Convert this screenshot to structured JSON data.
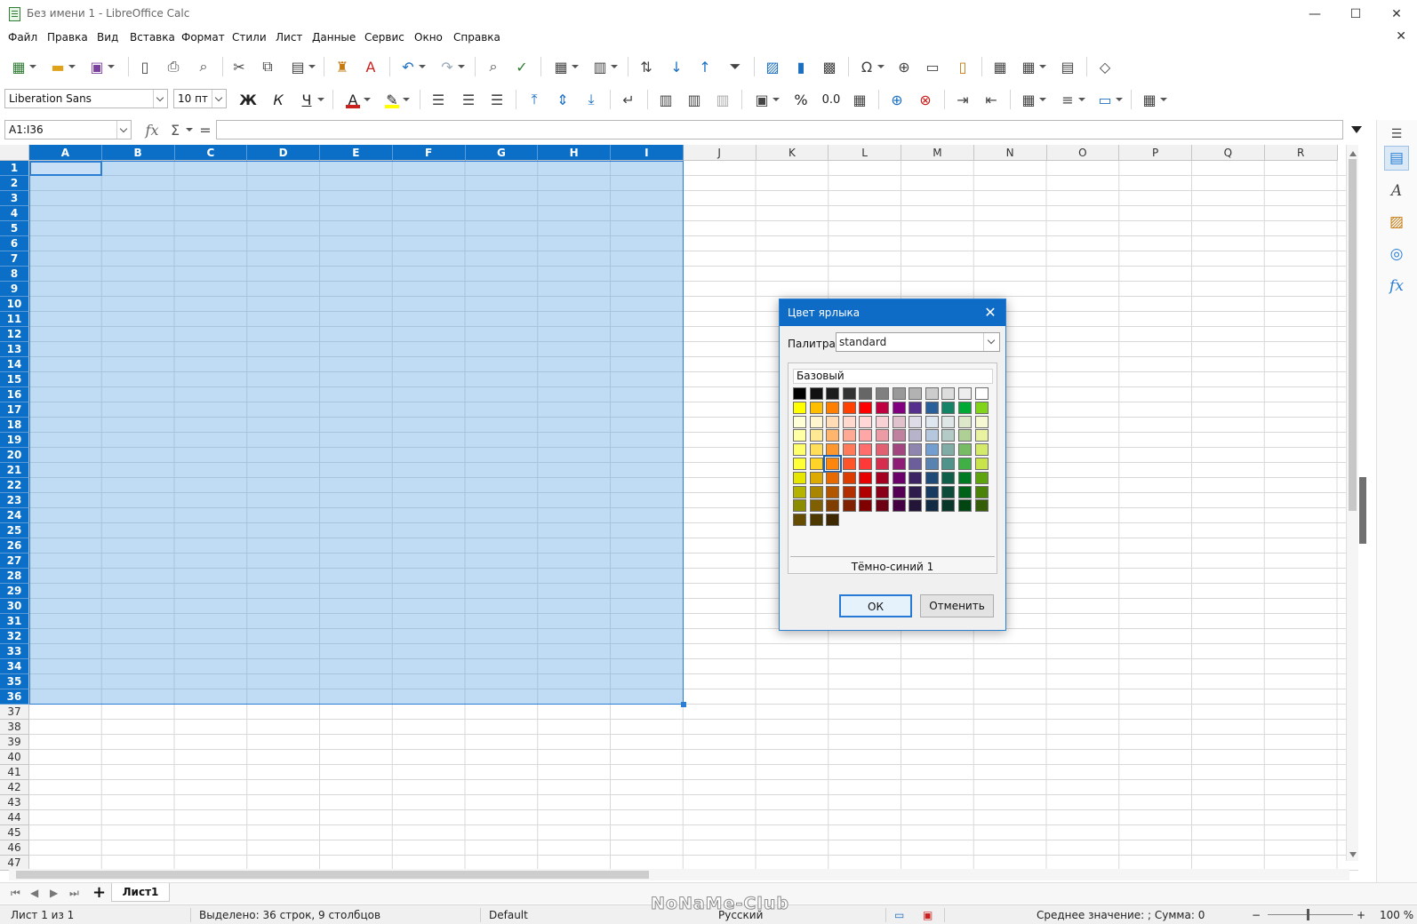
{
  "window": {
    "title": "Без имени 1 - LibreOffice Calc",
    "min": "—",
    "max": "☐",
    "close": "✕"
  },
  "menu": [
    "Файл",
    "Правка",
    "Вид",
    "Вставка",
    "Формат",
    "Стили",
    "Лист",
    "Данные",
    "Сервис",
    "Окно",
    "Справка"
  ],
  "doc_close": "✕",
  "format": {
    "font_name": "Liberation Sans",
    "font_size": "10 пт",
    "bold": "Ж",
    "italic": "К",
    "underline": "Ч",
    "font_color": "#c9211e",
    "highlight_color": "#ffff00",
    "percent": "%",
    "decimal": "0.0"
  },
  "formula_bar": {
    "name_box": "A1:I36",
    "fx": "fx",
    "sum": "Σ",
    "equals": "=",
    "value": ""
  },
  "grid": {
    "columns": [
      "A",
      "B",
      "C",
      "D",
      "E",
      "F",
      "G",
      "H",
      "I",
      "J",
      "K",
      "L",
      "M",
      "N",
      "O",
      "P",
      "Q",
      "R"
    ],
    "selected_columns": [
      "A",
      "B",
      "C",
      "D",
      "E",
      "F",
      "G",
      "H",
      "I"
    ],
    "rows_start": 1,
    "rows_end": 47,
    "selected_rows_end": 36
  },
  "sheet_tabs": {
    "add": "+",
    "tabs": [
      "Лист1"
    ]
  },
  "status": {
    "sheet": "Лист 1 из 1",
    "selection": "Выделено: 36 строк, 9 столбцов",
    "style": "Default",
    "language": "Русский",
    "summary": "Среднее значение: ; Сумма: 0",
    "zoom": "100 %"
  },
  "watermark": "NoNaMe-Club",
  "dialog": {
    "title": "Цвет ярлыка",
    "palette_label": "Палитра:",
    "palette_value": "standard",
    "palette_group": "Базовый",
    "selected_color_name": "Тёмно-синий 1",
    "ok": "ОК",
    "cancel": "Отменить",
    "selected_index": 62,
    "swatches": [
      "#000000",
      "#111111",
      "#1c1c1c",
      "#333333",
      "#666666",
      "#808080",
      "#999999",
      "#b2b2b2",
      "#cccccc",
      "#dddddd",
      "#eeeeee",
      "#ffffff",
      "#ffff00",
      "#ffbf00",
      "#ff8000",
      "#ff4000",
      "#ff0000",
      "#bf0041",
      "#800080",
      "#55308d",
      "#2a6099",
      "#158466",
      "#00a933",
      "#81d41a",
      "#ffffd7",
      "#fff5ce",
      "#ffdbb6",
      "#ffd8ce",
      "#ffd7d7",
      "#f7d1d5",
      "#e0c2cd",
      "#dedce6",
      "#dee6ef",
      "#dee7e5",
      "#dde8cb",
      "#f6f9d4",
      "#ffffa6",
      "#ffe994",
      "#ffb66c",
      "#ffaa95",
      "#ffa6a6",
      "#ec9ba4",
      "#bf819e",
      "#b7b3ca",
      "#b4c7dc",
      "#b3cac7",
      "#afd095",
      "#e8f2a1",
      "#ffff6d",
      "#ffde59",
      "#ff972f",
      "#ff7b59",
      "#ff6d6d",
      "#e16173",
      "#a1467e",
      "#8e86ae",
      "#729fcf",
      "#81aca6",
      "#77bc65",
      "#d4ea6b",
      "#ffff38",
      "#ffd428",
      "#ff860d",
      "#ff5429",
      "#ff3838",
      "#d62e4e",
      "#8d1d75",
      "#6b5e9b",
      "#5983b0",
      "#50938a",
      "#3faf46",
      "#c9e44b",
      "#e6e600",
      "#dcaa00",
      "#e66a00",
      "#dc3c00",
      "#e60000",
      "#a50021",
      "#6a006a",
      "#3c2463",
      "#1e4a78",
      "#0f5e49",
      "#007a22",
      "#5ea40e",
      "#b4b400",
      "#aa8500",
      "#b25600",
      "#b12f00",
      "#b00000",
      "#890018",
      "#540054",
      "#2e1c4d",
      "#173b60",
      "#0c4b3a",
      "#006119",
      "#4b8208",
      "#8c8c00",
      "#805f00",
      "#803d00",
      "#802200",
      "#800000",
      "#6d0013",
      "#430043",
      "#231537",
      "#112b44",
      "#083729",
      "#004512",
      "#355d05",
      "#664c00",
      "#4d3800",
      "#3d2800"
    ]
  }
}
